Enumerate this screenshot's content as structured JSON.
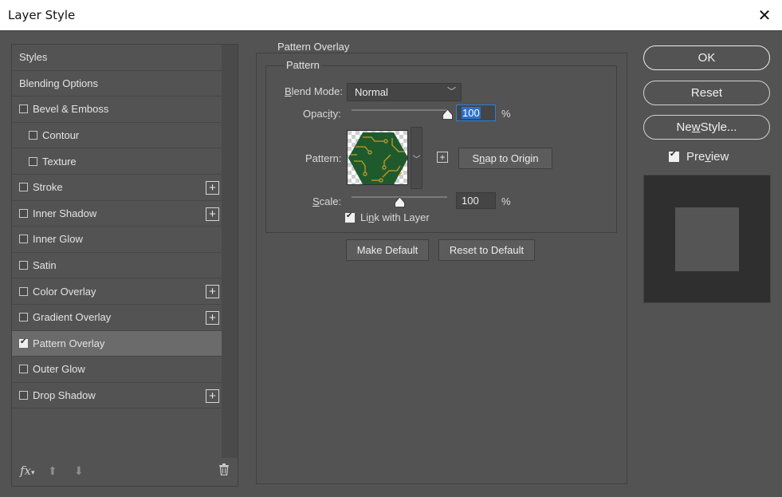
{
  "window": {
    "title": "Layer Style"
  },
  "styles": [
    {
      "label": "Styles",
      "checkbox": false,
      "plus": false,
      "indent": false,
      "checked": false,
      "selected": false
    },
    {
      "label": "Blending Options",
      "checkbox": false,
      "plus": false,
      "indent": false,
      "checked": false,
      "selected": false
    },
    {
      "label": "Bevel & Emboss",
      "checkbox": true,
      "plus": false,
      "indent": false,
      "checked": false,
      "selected": false
    },
    {
      "label": "Contour",
      "checkbox": true,
      "plus": false,
      "indent": true,
      "checked": false,
      "selected": false
    },
    {
      "label": "Texture",
      "checkbox": true,
      "plus": false,
      "indent": true,
      "checked": false,
      "selected": false
    },
    {
      "label": "Stroke",
      "checkbox": true,
      "plus": true,
      "indent": false,
      "checked": false,
      "selected": false
    },
    {
      "label": "Inner Shadow",
      "checkbox": true,
      "plus": true,
      "indent": false,
      "checked": false,
      "selected": false
    },
    {
      "label": "Inner Glow",
      "checkbox": true,
      "plus": false,
      "indent": false,
      "checked": false,
      "selected": false
    },
    {
      "label": "Satin",
      "checkbox": true,
      "plus": false,
      "indent": false,
      "checked": false,
      "selected": false
    },
    {
      "label": "Color Overlay",
      "checkbox": true,
      "plus": true,
      "indent": false,
      "checked": false,
      "selected": false
    },
    {
      "label": "Gradient Overlay",
      "checkbox": true,
      "plus": true,
      "indent": false,
      "checked": false,
      "selected": false
    },
    {
      "label": "Pattern Overlay",
      "checkbox": true,
      "plus": false,
      "indent": false,
      "checked": true,
      "selected": true
    },
    {
      "label": "Outer Glow",
      "checkbox": true,
      "plus": false,
      "indent": false,
      "checked": false,
      "selected": false
    },
    {
      "label": "Drop Shadow",
      "checkbox": true,
      "plus": true,
      "indent": false,
      "checked": false,
      "selected": false
    }
  ],
  "footer": {
    "fx_label": "fx",
    "fx_icon": "fx-icon",
    "up_icon": "arrow-up-icon",
    "down_icon": "arrow-down-icon",
    "trash_icon": "trash-icon"
  },
  "panel": {
    "title": "Pattern Overlay",
    "group_title": "Pattern",
    "blend_mode_label_accel": "B",
    "blend_mode_label_rest": "lend Mode:",
    "blend_mode_value": "Normal",
    "opacity_label_head": "Opac",
    "opacity_label_accel": "i",
    "opacity_label_tail": "ty:",
    "opacity_value": "100",
    "opacity_unit": "%",
    "opacity_level": 1.0,
    "pattern_label": "Pattern:",
    "snap_accel": "n",
    "snap_head": "S",
    "snap_tail": "ap to Origin",
    "scale_label_accel": "S",
    "scale_label_rest": "cale:",
    "scale_value": "100",
    "scale_unit": "%",
    "scale_level": 0.5,
    "link_label_head": "Li",
    "link_label_accel": "n",
    "link_label_tail": "k with Layer",
    "link_checked": true,
    "make_default": "Make Default",
    "reset_default": "Reset to Default"
  },
  "right": {
    "ok": "OK",
    "reset": "Reset",
    "new_style_head": "Ne",
    "new_style_accel": "w",
    "new_style_tail": " Style...",
    "preview_head": "Pre",
    "preview_accel": "v",
    "preview_tail": "iew",
    "preview_checked": true
  },
  "colors": {
    "pattern_green": "#1f5a2c",
    "pattern_gold": "#c79a2a",
    "highlight": "#2c6fd0"
  }
}
